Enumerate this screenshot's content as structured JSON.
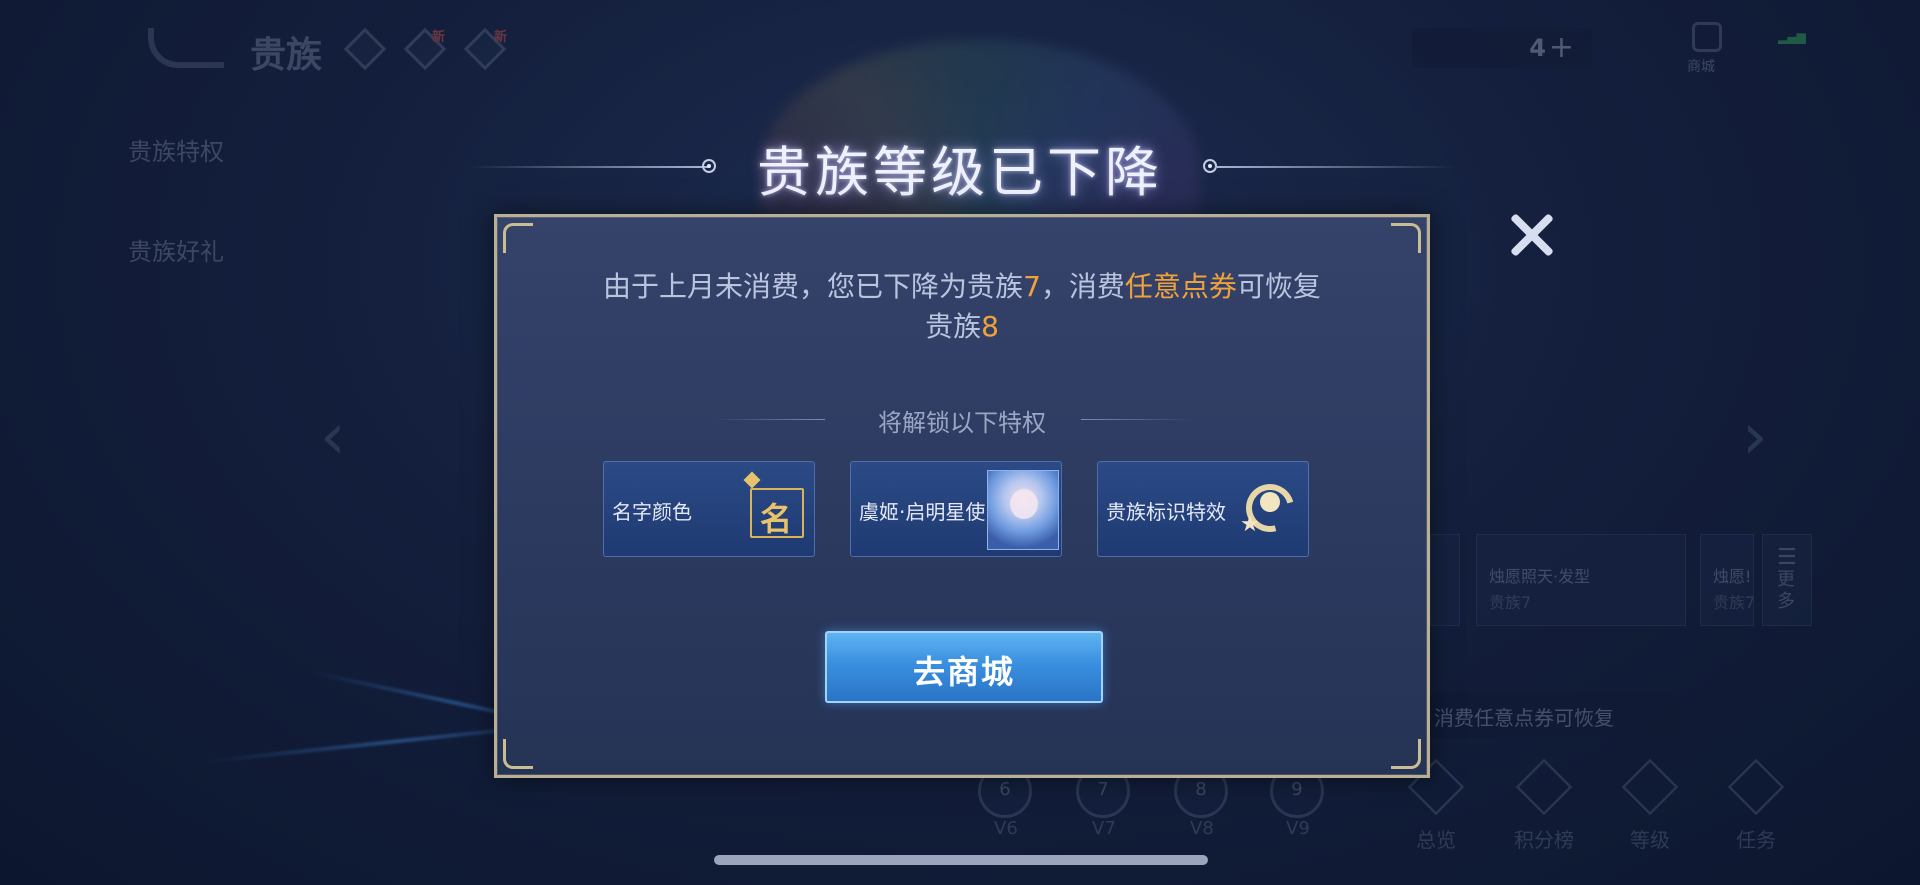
{
  "background": {
    "page_title": "贵族",
    "new_badge_1": "新",
    "new_badge_2": "新",
    "coin_count": "4",
    "coin_plus": "+",
    "shop_label": "商城",
    "side_menu": [
      {
        "label": "贵族特权"
      },
      {
        "label": "贵族好礼"
      }
    ],
    "reward_cards": [
      {
        "title": "烛愿照天·发型",
        "level": "贵族7"
      },
      {
        "title": "烛愿!",
        "level": "贵族7"
      }
    ],
    "more_label": "更多",
    "tooltip": "消费任意点券可恢复",
    "levels": [
      {
        "num": "6",
        "label": "V6"
      },
      {
        "num": "7",
        "label": "V7"
      },
      {
        "num": "8",
        "label": "V8"
      },
      {
        "num": "9",
        "label": "V9"
      }
    ],
    "bottom_tabs": [
      {
        "label": "总览"
      },
      {
        "label": "积分榜"
      },
      {
        "label": "等级"
      },
      {
        "label": "任务"
      }
    ]
  },
  "modal": {
    "title": "贵族等级已下降",
    "message_part1": "由于上月未消费，您已下降为贵族",
    "message_level_current": "7",
    "message_part2": "，消费",
    "message_highlight": "任意点券",
    "message_part3": "可恢复",
    "message_part4": "贵族",
    "message_level_restore": "8",
    "section_label": "将解锁以下特权",
    "perks": [
      {
        "label": "名字颜色",
        "icon_text": "名"
      },
      {
        "label": "虞姬·启明星使"
      },
      {
        "label": "贵族标识特效"
      }
    ],
    "shop_button": "去商城"
  },
  "colors": {
    "highlight": "#f0a23a",
    "button_blue": "#3a8fe0",
    "panel_border": "#b9b091"
  }
}
